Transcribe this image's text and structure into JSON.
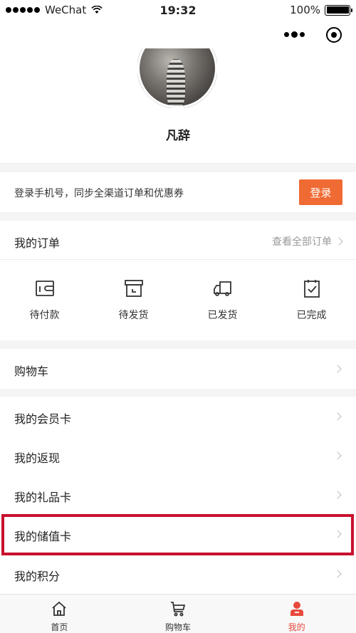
{
  "status_bar": {
    "carrier": "WeChat",
    "time": "19:32",
    "battery": "100%"
  },
  "profile": {
    "name": "凡辞"
  },
  "login": {
    "prompt": "登录手机号，同步全渠道订单和优惠券",
    "button_label": "登录",
    "button_color": "#f06a33"
  },
  "orders": {
    "title": "我的订单",
    "view_all": "查看全部订单",
    "items": [
      {
        "label": "待付款",
        "icon": "wallet-icon"
      },
      {
        "label": "待发货",
        "icon": "box-icon"
      },
      {
        "label": "已发货",
        "icon": "truck-icon"
      },
      {
        "label": "已完成",
        "icon": "clipboard-check-icon"
      }
    ]
  },
  "menu": {
    "cart": "购物车",
    "member_card": "我的会员卡",
    "cashback": "我的返现",
    "gift_card": "我的礼品卡",
    "stored_value_card": "我的储值卡",
    "points": "我的积分"
  },
  "tabs": [
    {
      "label": "首页",
      "icon": "home-icon"
    },
    {
      "label": "购物车",
      "icon": "cart-icon"
    },
    {
      "label": "我的",
      "icon": "user-icon",
      "active": true
    }
  ],
  "colors": {
    "accent": "#e8493c",
    "highlight_border": "#c8102e"
  }
}
